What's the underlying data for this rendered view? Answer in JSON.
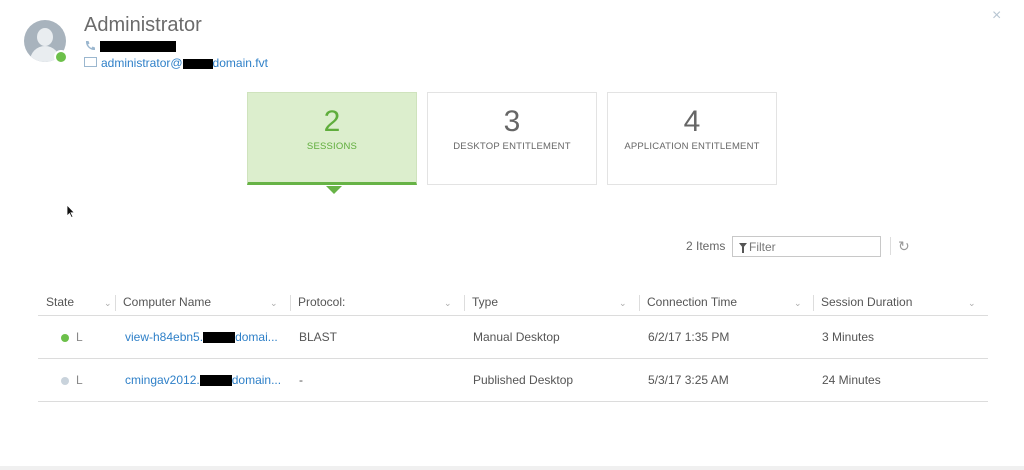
{
  "user": {
    "name": "Administrator",
    "email_prefix": "administrator@",
    "email_suffix": "domain.fvt"
  },
  "close": {
    "icon": "close-icon",
    "label": "×"
  },
  "cards": [
    {
      "count": "2",
      "label": "SESSIONS",
      "active": true
    },
    {
      "count": "3",
      "label": "DESKTOP ENTITLEMENT",
      "active": false
    },
    {
      "count": "4",
      "label": "APPLICATION ENTITLEMENT",
      "active": false
    }
  ],
  "toolbar": {
    "items_count": "2 Items",
    "filter_placeholder": "Filter",
    "refresh_icon": "↻"
  },
  "table": {
    "columns": [
      "State",
      "Computer Name",
      "Protocol:",
      "Type",
      "Connection Time",
      "Session Duration"
    ],
    "rows": [
      {
        "state_color": "#6cc04a",
        "state": "L",
        "computer_prefix": "view-h84ebn5.",
        "computer_suffix": "domai...",
        "protocol": "BLAST",
        "type": "Manual Desktop",
        "connection_time": "6/2/17 1:35 PM",
        "session_duration": "3 Minutes"
      },
      {
        "state_color": "#c9d3dc",
        "state": "L",
        "computer_prefix": "cmingav2012.",
        "computer_suffix": "domain...",
        "protocol": "-",
        "type": "Published Desktop",
        "connection_time": "5/3/17 3:25 AM",
        "session_duration": "24 Minutes"
      }
    ]
  },
  "colors": {
    "accent_green": "#67b346",
    "link_blue": "#2f80c8"
  }
}
